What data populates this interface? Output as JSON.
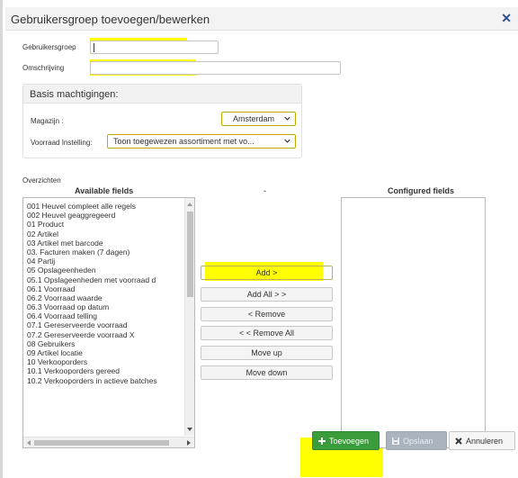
{
  "dialog": {
    "title": "Gebruikersgroep toevoegen/bewerken"
  },
  "form": {
    "group_label": "Gebruikersgroep",
    "group_value": "",
    "description_label": "Omschrijving",
    "description_value": ""
  },
  "permissions": {
    "title": "Basis machtigingen:",
    "warehouse_label": "Magazijn :",
    "warehouse_value": "Amsterdam",
    "stock_label": "Voorraad Instelling:",
    "stock_value": "Toon toegewezen assortiment met vo..."
  },
  "overviews": {
    "label": "Overzichten",
    "available_header": "Available fields",
    "middle_header": "-",
    "configured_header": "Configured fields",
    "available_fields": [
      "001 Heuvel compleet alle regels",
      "002 Heuvel geaggregeerd",
      "01 Product",
      "02 Artikel",
      "03 Artikel met barcode",
      "03. Facturen maken (7 dagen)",
      "04 Partij",
      "05 Opslageenheden",
      "05.1 Opslageenheden met voorraad d",
      "06.1 Voorraad",
      "06.2 Voorraad waarde",
      "06.3 Voorraad op datum",
      "06.4 Voorraad telling",
      "07.1 Gereserveerde voorraad",
      "07.2 Gereserveerde voorraad X",
      "08 Gebruikers",
      "09 Artikel locatie",
      "10 Verkooporders",
      "10.1 Verkooporders gereed",
      "10.2 Verkooporders in actieve batches"
    ],
    "configured_fields": []
  },
  "actions": {
    "add": "Add >",
    "add_all": "Add All > >",
    "remove": "< Remove",
    "remove_all": "< < Remove All",
    "move_up": "Move up",
    "move_down": "Move down"
  },
  "footer": {
    "add_label": "Toevoegen",
    "save_label": "Opslaan",
    "cancel_label": "Annuleren"
  },
  "colors": {
    "highlight": "#ffff00",
    "primary_button": "#3a9c3a",
    "disabled_button": "#a9b4bf",
    "close_icon": "#2f4f8f"
  },
  "icons": [
    "close-icon",
    "chevron-down-icon",
    "plus-icon",
    "save-icon"
  ]
}
